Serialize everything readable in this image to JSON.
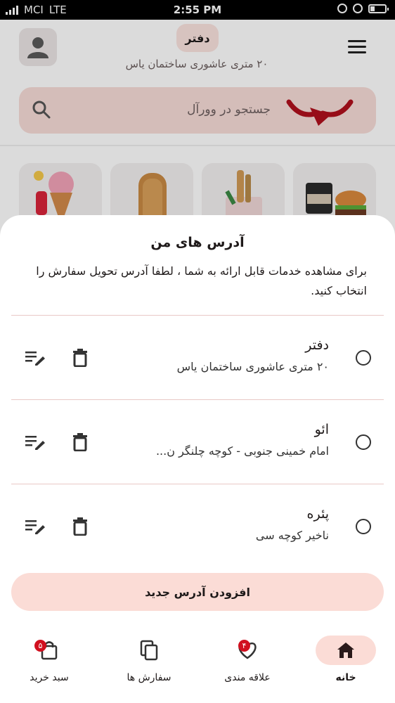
{
  "status_bar": {
    "carrier": "MCI",
    "network": "LTE",
    "time": "2:55 PM"
  },
  "header": {
    "title": "دفتر",
    "subtitle": "۲۰ متری عاشوری ساختمان یاس"
  },
  "search": {
    "placeholder": "جستجو در وورآل"
  },
  "sheet": {
    "title": "آدرس های من",
    "description": "برای مشاهده خدمات قابل ارائه به شما ، لطفا آدرس تحویل سفارش را انتخاب کنید.",
    "addresses": [
      {
        "name": "دفتر",
        "line": "۲۰ متری عاشوری ساختمان یاس"
      },
      {
        "name": "ائو",
        "line": "امام خمینی جنوبی - کوچه چلنگر ن..."
      },
      {
        "name": "پئره",
        "line": "ناخیر کوچه سی"
      }
    ],
    "add_button": "افزودن آدرس جدید"
  },
  "bottom_nav": {
    "home": "خانه",
    "favorites": "علاقه مندی",
    "favorites_badge": "۴",
    "orders": "سفارش ها",
    "cart": "سبد خرید",
    "cart_badge": "۵"
  },
  "colors": {
    "accent": "#c0121e",
    "pill": "#fbdcd6",
    "divider": "#e9c9c6"
  }
}
